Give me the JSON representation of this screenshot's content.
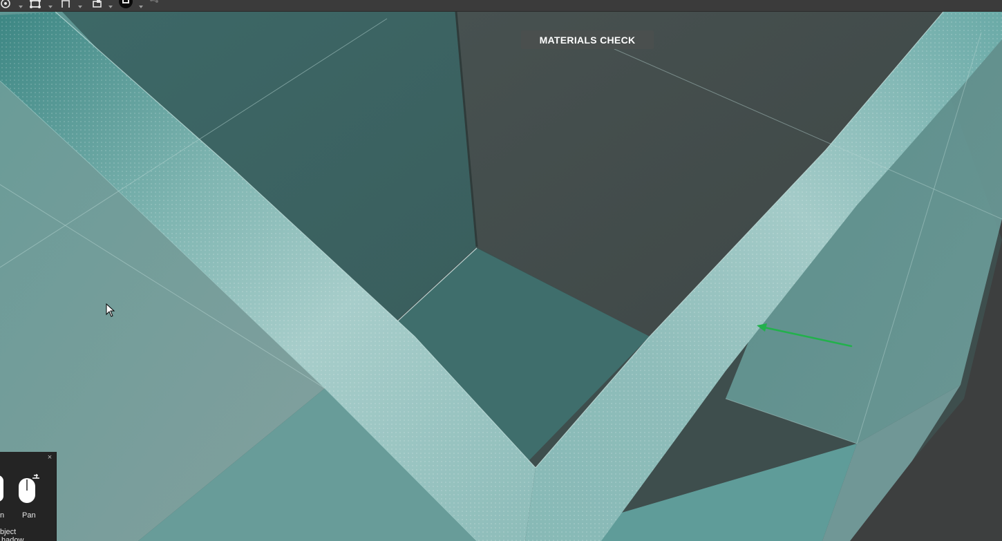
{
  "toolbar": {
    "tools": [
      {
        "icon": "orbit-icon"
      },
      {
        "icon": "select-box-icon"
      },
      {
        "icon": "measure-icon"
      },
      {
        "icon": "section-icon"
      },
      {
        "icon": "render-mode-icon"
      },
      {
        "icon": "tree-icon"
      }
    ]
  },
  "viewport": {
    "view_label": "MATERIALS CHECK",
    "background_color": "#3f4746",
    "glass_color": "#4f8f8c"
  },
  "hint_panel": {
    "close_symbol": "×",
    "items": [
      {
        "label": "n",
        "icon": "mouse-icon"
      },
      {
        "label": "Pan",
        "icon": "mouse-pan-icon"
      }
    ],
    "extra_text": [
      "bject",
      "hadow"
    ]
  },
  "annotation": {
    "arrow_color": "#22b14c"
  }
}
